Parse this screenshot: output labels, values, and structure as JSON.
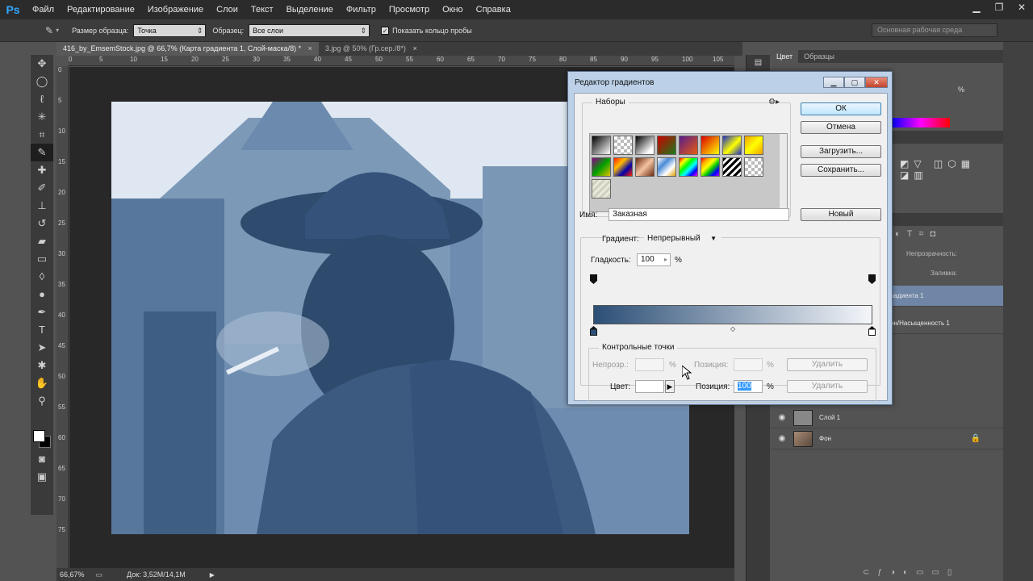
{
  "app": {
    "logo": "Ps"
  },
  "menu": [
    "Файл",
    "Редактирование",
    "Изображение",
    "Слои",
    "Текст",
    "Выделение",
    "Фильтр",
    "Просмотр",
    "Окно",
    "Справка"
  ],
  "window_controls": {
    "minimize": "▁",
    "restore": "❐",
    "close": "✕"
  },
  "options": {
    "sample_size_label": "Размер образца:",
    "sample_size_value": "Точка",
    "sample_label": "Образец:",
    "sample_value": "Все слои",
    "show_ring_label": "Показать кольцо пробы",
    "show_ring_checked": true,
    "workspace": "Основная рабочая среда"
  },
  "doc_tabs": [
    {
      "label": "416_by_EmsemStock.jpg @ 66,7% (Карта градиента 1, Слой-маска/8) *",
      "close": "×"
    },
    {
      "label": "3.jpg @ 50% (Гр.сер./8*)",
      "close": "×"
    }
  ],
  "ruler_h": [
    "0",
    "5",
    "10",
    "15",
    "20",
    "25",
    "30",
    "35",
    "40",
    "45",
    "50",
    "55",
    "60",
    "65",
    "70",
    "75",
    "80",
    "85",
    "90",
    "95",
    "100",
    "105"
  ],
  "ruler_v": [
    "0",
    "5",
    "10",
    "15",
    "20",
    "25",
    "30",
    "35",
    "40",
    "45",
    "50",
    "55",
    "60",
    "65",
    "70",
    "75"
  ],
  "status": {
    "zoom": "66,67%",
    "doc": "Док: 3,52M/14,1M"
  },
  "colors": {
    "foreground": "#ffffff",
    "background": "#000000",
    "photo_tint": "#5f7ea2"
  },
  "right_panel": {
    "tabs": [
      "Цвет",
      "Образцы"
    ],
    "opacity_label": "Непрозрачность:",
    "fill_label": "Заливка:",
    "percent_value": "%",
    "layers": [
      {
        "name": "радиента 1",
        "visible": false
      },
      {
        "name": "он/Насыщенность 1",
        "visible": false
      },
      {
        "name": "Слой 1",
        "visible": true
      },
      {
        "name": "Фон",
        "visible": true,
        "locked": true
      }
    ]
  },
  "dialog": {
    "title": "Редактор градиентов",
    "presets_label": "Наборы",
    "buttons": {
      "ok": "ОК",
      "cancel": "Отмена",
      "load": "Загрузить...",
      "save": "Сохранить...",
      "new": "Новый"
    },
    "name_label": "Имя:",
    "name_value": "Заказная",
    "gradient_type_label": "Градиент:",
    "gradient_type_value": "Непрерывный",
    "smoothness_label": "Гладкость:",
    "smoothness_value": "100",
    "percent": "%",
    "stops_group": "Контрольные точки",
    "opacity_label": "Непрозр.:",
    "position_label": "Позиция:",
    "delete_label": "Удалить",
    "color_label": "Цвет:",
    "color_position_value": "100",
    "gradient_start": "#2c4f76",
    "gradient_end": "#f4f6fa"
  }
}
